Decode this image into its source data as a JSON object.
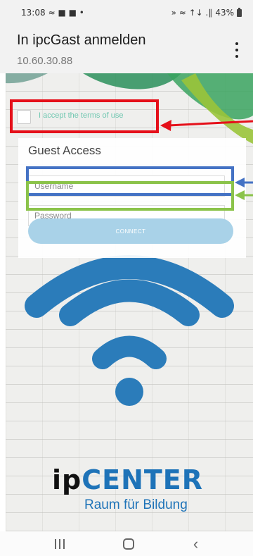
{
  "status_bar": {
    "time": "13:08",
    "left_icons": "≈ ■ ■ •",
    "signal_text": "» ≈ ↑↓ .∥",
    "battery": "43%"
  },
  "app_bar": {
    "title": "In ipcGast anmelden",
    "subtitle": "10.60.30.88",
    "menu_icon": "more-vert-icon"
  },
  "terms": {
    "label": "I accept the terms of use",
    "checked": false
  },
  "login": {
    "title": "Guest Access",
    "username_placeholder": "Username",
    "password_placeholder": "Password",
    "connect_label": "CONNECT"
  },
  "logo": {
    "ip": "ip",
    "center": "CENTER",
    "slogan": "Raum für Bildung"
  },
  "nav_bar": {
    "back_icon": "‹",
    "home_icon": "home-icon",
    "recents_icon": "recents-icon"
  },
  "colors": {
    "accent": "#6fc7b0",
    "brand_blue": "#1e73b8",
    "wifi": "#2b7cba",
    "annotation_red": "#e5101a",
    "annotation_blue": "#4472c4",
    "annotation_green": "#8bc34a"
  }
}
